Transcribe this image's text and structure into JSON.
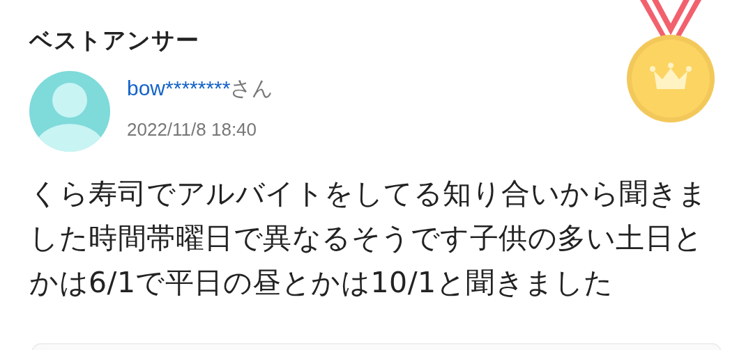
{
  "heading": "ベストアンサー",
  "answer": {
    "user_name": "bow********",
    "honorific": "さん",
    "date": "2022/11/8 18:40",
    "body": "くら寿司でアルバイトをしてる知り合いから聞きました時間帯曜日で異なるそうです子供の多い土日とかは6/1で平日の昼とかは10/1と聞きました"
  }
}
